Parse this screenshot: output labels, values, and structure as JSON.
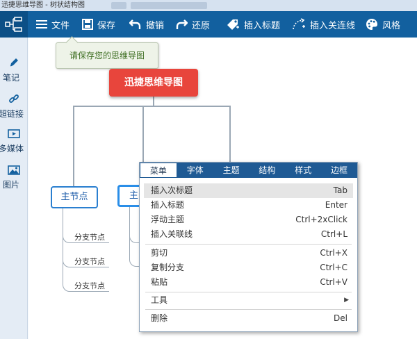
{
  "window": {
    "title": "迅捷思维导图 - 树状结构图"
  },
  "toolbar": {
    "items": [
      {
        "label": "文件",
        "icon": "hamburger-menu-icon"
      },
      {
        "label": "保存",
        "icon": "save-icon"
      },
      {
        "label": "撤销",
        "icon": "undo-icon"
      },
      {
        "label": "还原",
        "icon": "redo-icon"
      },
      {
        "label": "插入标题",
        "icon": "insert-topic-icon"
      },
      {
        "label": "插入关连线",
        "icon": "insert-relation-icon"
      },
      {
        "label": "风格",
        "icon": "palette-icon"
      }
    ]
  },
  "sidebar": {
    "items": [
      {
        "label": "笔记",
        "icon": "pen-icon"
      },
      {
        "label": "超链接",
        "icon": "link-icon"
      },
      {
        "label": "多媒体",
        "icon": "media-icon"
      },
      {
        "label": "图片",
        "icon": "image-icon"
      }
    ]
  },
  "tooltip": {
    "text": "请保存您的思维导图"
  },
  "mindmap": {
    "root": "迅捷思维导图",
    "main_nodes": [
      "主节点",
      "主"
    ],
    "branches": [
      "分支节点",
      "分支节点",
      "分支节点"
    ]
  },
  "context_menu": {
    "tabs": [
      "菜单",
      "字体",
      "主题",
      "结构",
      "样式",
      "边框"
    ],
    "items": [
      {
        "label": "插入次标题",
        "shortcut": "Tab"
      },
      {
        "label": "插入标题",
        "shortcut": "Enter"
      },
      {
        "label": "浮动主题",
        "shortcut": "Ctrl+2xClick"
      },
      {
        "label": "插入关联线",
        "shortcut": "Ctrl+L"
      },
      {
        "label": "剪切",
        "shortcut": "Ctrl+X"
      },
      {
        "label": "复制分支",
        "shortcut": "Ctrl+C"
      },
      {
        "label": "粘贴",
        "shortcut": "Ctrl+V"
      },
      {
        "label": "工具",
        "shortcut": ""
      },
      {
        "label": "删除",
        "shortcut": "Del"
      }
    ]
  },
  "colors": {
    "toolbar": "#12609f",
    "root_node": "#e8453c",
    "node_border": "#2a7fd0",
    "menu_tabs": "#1f5a94",
    "tooltip_text": "#3d6e21"
  }
}
